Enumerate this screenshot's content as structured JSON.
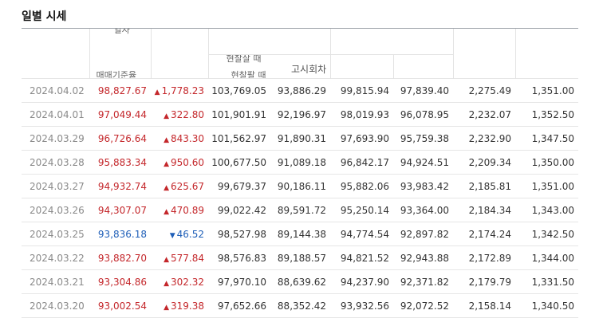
{
  "section_title": "일별 시세",
  "header": {
    "date_label_clipped": "일자",
    "close_label_clipped": "매매기준율",
    "cash_buy_label_clipped": "현찰살 때",
    "cash_sell_label_clipped": "현찰팔 때",
    "notice_label": "고시회차"
  },
  "rows": [
    {
      "date": "2024.04.02",
      "close": "98,827.67",
      "dir": "up",
      "change": "1,778.23",
      "c3": "103,769.05",
      "c4": "93,886.29",
      "c5": "99,815.94",
      "c6": "97,839.40",
      "c7": "2,275.49",
      "c8": "1,351.00"
    },
    {
      "date": "2024.04.01",
      "close": "97,049.44",
      "dir": "up",
      "change": "322.80",
      "c3": "101,901.91",
      "c4": "92,196.97",
      "c5": "98,019.93",
      "c6": "96,078.95",
      "c7": "2,232.07",
      "c8": "1,352.50"
    },
    {
      "date": "2024.03.29",
      "close": "96,726.64",
      "dir": "up",
      "change": "843.30",
      "c3": "101,562.97",
      "c4": "91,890.31",
      "c5": "97,693.90",
      "c6": "95,759.38",
      "c7": "2,232.90",
      "c8": "1,347.50"
    },
    {
      "date": "2024.03.28",
      "close": "95,883.34",
      "dir": "up",
      "change": "950.60",
      "c3": "100,677.50",
      "c4": "91,089.18",
      "c5": "96,842.17",
      "c6": "94,924.51",
      "c7": "2,209.34",
      "c8": "1,350.00"
    },
    {
      "date": "2024.03.27",
      "close": "94,932.74",
      "dir": "up",
      "change": "625.67",
      "c3": "99,679.37",
      "c4": "90,186.11",
      "c5": "95,882.06",
      "c6": "93,983.42",
      "c7": "2,185.81",
      "c8": "1,351.00"
    },
    {
      "date": "2024.03.26",
      "close": "94,307.07",
      "dir": "up",
      "change": "470.89",
      "c3": "99,022.42",
      "c4": "89,591.72",
      "c5": "95,250.14",
      "c6": "93,364.00",
      "c7": "2,184.34",
      "c8": "1,343.00"
    },
    {
      "date": "2024.03.25",
      "close": "93,836.18",
      "dir": "down",
      "change": "46.52",
      "c3": "98,527.98",
      "c4": "89,144.38",
      "c5": "94,774.54",
      "c6": "92,897.82",
      "c7": "2,174.24",
      "c8": "1,342.50"
    },
    {
      "date": "2024.03.22",
      "close": "93,882.70",
      "dir": "up",
      "change": "577.84",
      "c3": "98,576.83",
      "c4": "89,188.57",
      "c5": "94,821.52",
      "c6": "92,943.88",
      "c7": "2,172.89",
      "c8": "1,344.00"
    },
    {
      "date": "2024.03.21",
      "close": "93,304.86",
      "dir": "up",
      "change": "302.32",
      "c3": "97,970.10",
      "c4": "88,639.62",
      "c5": "94,237.90",
      "c6": "92,371.82",
      "c7": "2,179.79",
      "c8": "1,331.50"
    },
    {
      "date": "2024.03.20",
      "close": "93,002.54",
      "dir": "up",
      "change": "319.38",
      "c3": "97,652.66",
      "c4": "88,352.42",
      "c5": "93,932.56",
      "c6": "92,072.52",
      "c7": "2,158.14",
      "c8": "1,340.50"
    }
  ],
  "colors": {
    "up": "#c4272b",
    "down": "#1f5fb8"
  },
  "icons": {
    "up": "triangle-up-icon",
    "down": "triangle-down-icon"
  }
}
